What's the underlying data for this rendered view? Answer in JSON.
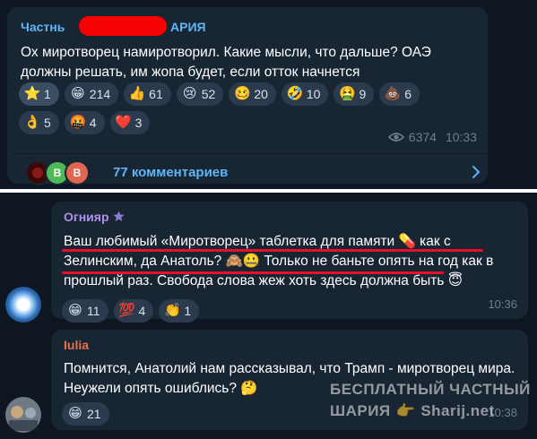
{
  "post": {
    "author_prefix": "Частнь",
    "author_suffix": "АРИЯ",
    "text": "Ох миротворец намиротворил. Какие мысли, что дальше? ОАЭ должны решать, им жопа будет, если отток начнется",
    "reactions_row1": [
      {
        "emoji": "⭐",
        "count": "1",
        "icon": "star-icon",
        "active": true
      },
      {
        "emoji": "😁",
        "count": "214",
        "icon": "grin-icon"
      },
      {
        "emoji": "👍",
        "count": "61",
        "icon": "thumbs-up-icon"
      },
      {
        "emoji": "😢",
        "count": "52",
        "icon": "cry-icon"
      },
      {
        "emoji": "🥴",
        "count": "20",
        "icon": "woozy-icon"
      },
      {
        "emoji": "🤣",
        "count": "10",
        "icon": "rofl-icon"
      },
      {
        "emoji": "🤮",
        "count": "9",
        "icon": "vomit-icon"
      },
      {
        "emoji": "💩",
        "count": "6",
        "icon": "poop-icon"
      }
    ],
    "reactions_row2": [
      {
        "emoji": "👌",
        "count": "5",
        "icon": "ok-hand-icon"
      },
      {
        "emoji": "🤬",
        "count": "4",
        "icon": "cursing-icon"
      },
      {
        "emoji": "❤️",
        "count": "3",
        "icon": "heart-icon"
      }
    ],
    "views": "6374",
    "time": "10:33",
    "comments_label": "77 комментариев",
    "comment_avatars": [
      "",
      "В",
      "В"
    ]
  },
  "comments": [
    {
      "author": "Огнияр",
      "author_color": "#b090e8",
      "text": "Ваш любимый «Миротворец» таблетка для памяти 💊 как с Зелинским, да Анатоль? 🙈🤐 Только не баньте опять на год как в прошлый раз. Свобода слова жеж хоть здесь должна быть 😇",
      "reactions": [
        {
          "emoji": "😁",
          "count": "11",
          "icon": "grin-icon"
        },
        {
          "emoji": "💯",
          "count": "4",
          "icon": "hundred-icon"
        },
        {
          "emoji": "👏",
          "count": "1",
          "icon": "clap-icon"
        }
      ],
      "time": "10:36"
    },
    {
      "author": "Iulia",
      "author_color": "#e8724a",
      "text": "Помнится, Анатолий нам рассказывал, что Трамп -  миротворец мира. Неужели опять ошиблись? 🤔",
      "reactions": [
        {
          "emoji": "😁",
          "count": "21",
          "icon": "grin-icon"
        }
      ],
      "time": "10:38"
    }
  ],
  "watermark": {
    "line1": "БЕСПЛАТНЫЙ ЧАСТНЫЙ",
    "line2_left": "ШАРИЯ",
    "line2_icon": "👉",
    "line2_right": "Sharij.net"
  }
}
